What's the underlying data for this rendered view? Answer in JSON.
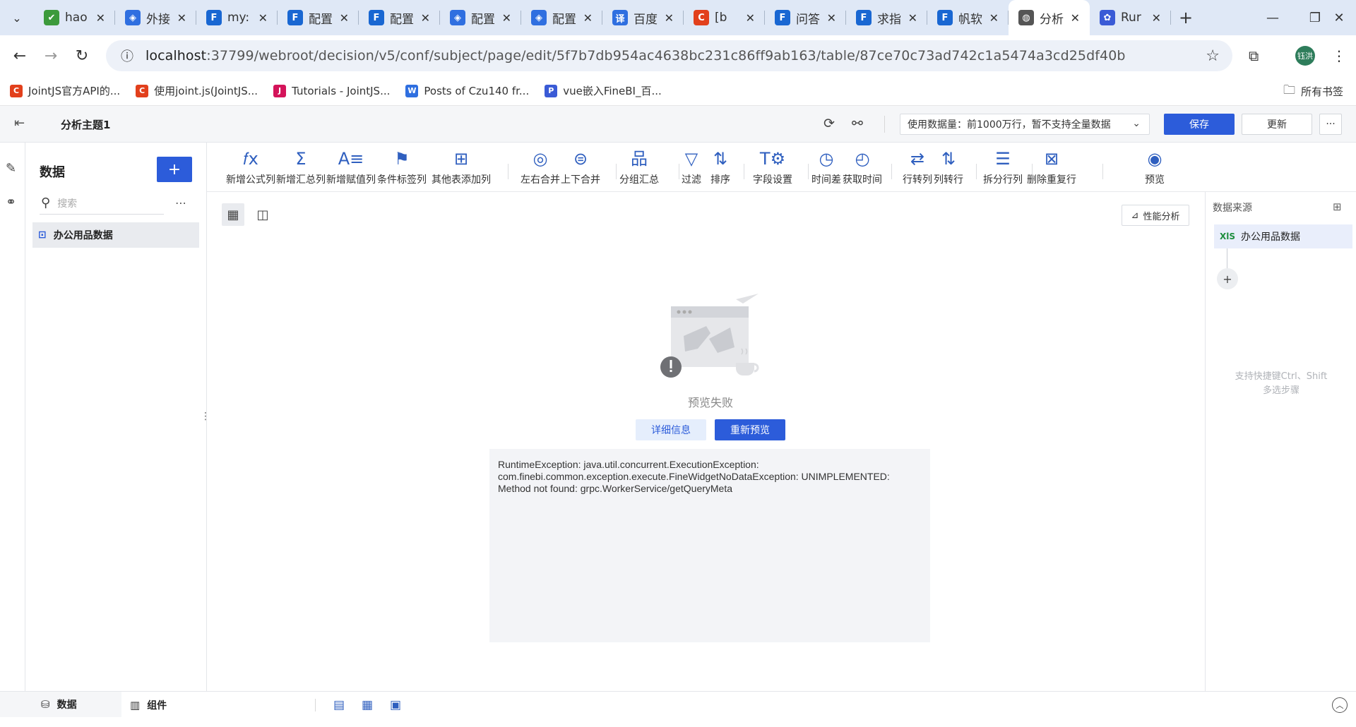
{
  "browser": {
    "tabs": [
      {
        "title": "hao",
        "favicon": "hao",
        "color": "#3c9a3c",
        "active": false
      },
      {
        "title": "外接",
        "favicon": "diamond",
        "color": "#2f6fe0",
        "active": false
      },
      {
        "title": "my:",
        "favicon": "fine",
        "color": "#1967d2",
        "active": false
      },
      {
        "title": "配置",
        "favicon": "fine",
        "color": "#1967d2",
        "active": false
      },
      {
        "title": "配置",
        "favicon": "fine",
        "color": "#1967d2",
        "active": false
      },
      {
        "title": "配置",
        "favicon": "diamond",
        "color": "#2f6fe0",
        "active": false
      },
      {
        "title": "配置",
        "favicon": "diamond",
        "color": "#2f6fe0",
        "active": false
      },
      {
        "title": "百度",
        "favicon": "译",
        "color": "#2f6fe0",
        "active": false
      },
      {
        "title": "[b",
        "favicon": "C",
        "color": "#e2401c",
        "active": false
      },
      {
        "title": "问答",
        "favicon": "fine",
        "color": "#1967d2",
        "active": false
      },
      {
        "title": "求指",
        "favicon": "fine",
        "color": "#1967d2",
        "active": false
      },
      {
        "title": "帆软",
        "favicon": "fine",
        "color": "#1967d2",
        "active": false
      },
      {
        "title": "分析",
        "favicon": "globe",
        "color": "#555555",
        "active": true
      },
      {
        "title": "Rur",
        "favicon": "paw",
        "color": "#3a5bd6",
        "active": false
      }
    ],
    "url_host": "localhost",
    "url_path": ":37799/webroot/decision/v5/conf/subject/page/edit/5f7b7db954ac4638bc231c86ff9ab163/table/87ce70c73ad742c1a5474a3cd25df40b",
    "avatar_text": "钰洪",
    "bookmarks": [
      {
        "label": "JointJS官方API的...",
        "icon": "C",
        "color": "#e2401c"
      },
      {
        "label": "使用joint.js(JointJS...",
        "icon": "C",
        "color": "#e2401c"
      },
      {
        "label": "Tutorials - JointJS...",
        "icon": "J",
        "color": "#d4145a"
      },
      {
        "label": "Posts of Czu140 fr...",
        "icon": "W",
        "color": "#2f6fe0"
      },
      {
        "label": "vue嵌入FineBI_百...",
        "icon": "P",
        "color": "#3a5bd6"
      }
    ],
    "all_bookmarks": "所有书签"
  },
  "app": {
    "title": "分析主题1",
    "data_limit": "使用数据量：前1000万行，暂不支持全量数据",
    "save": "保存",
    "update": "更新",
    "more": "···"
  },
  "data_panel": {
    "heading": "数据",
    "add": "+",
    "search_placeholder": "搜索",
    "item": "办公用品数据"
  },
  "toolbar": [
    {
      "label": "新增公式列",
      "icon": "𝑓x"
    },
    {
      "label": "新增汇总列",
      "icon": "Σ"
    },
    {
      "label": "新增赋值列",
      "icon": "A≡"
    },
    {
      "label": "条件标签列",
      "icon": "⚑"
    },
    {
      "label": "其他表添加列",
      "icon": "⊞"
    },
    {
      "label": "左右合并",
      "icon": "◎"
    },
    {
      "label": "上下合并",
      "icon": "⊜"
    },
    {
      "label": "分组汇总",
      "icon": "品"
    },
    {
      "label": "过滤",
      "icon": "▽"
    },
    {
      "label": "排序",
      "icon": "⇅"
    },
    {
      "label": "字段设置",
      "icon": "T⚙"
    },
    {
      "label": "时间差",
      "icon": "◷"
    },
    {
      "label": "获取时间",
      "icon": "◴"
    },
    {
      "label": "行转列",
      "icon": "⇄"
    },
    {
      "label": "列转行",
      "icon": "⇅"
    },
    {
      "label": "拆分行列",
      "icon": "☰"
    },
    {
      "label": "删除重复行",
      "icon": "⊠"
    },
    {
      "label": "预览",
      "icon": "◉"
    }
  ],
  "main": {
    "perf_label": "性能分析",
    "fail_text": "预览失败",
    "detail_btn": "详细信息",
    "retry_btn": "重新预览",
    "error_line1": "RuntimeException: java.util.concurrent.ExecutionException:",
    "error_line2": "com.finebi.common.exception.execute.FineWidgetNoDataException: UNIMPLEMENTED:",
    "error_line3": "Method not found: grpc.WorkerService/getQueryMeta"
  },
  "right_panel": {
    "heading": "数据来源",
    "source_badge": "XlS",
    "source": "办公用品数据",
    "add": "+",
    "hint_line1": "支持快捷键Ctrl、Shift",
    "hint_line2": "多选步骤"
  },
  "bottom": {
    "tab_data": "数据",
    "tab_component": "组件"
  }
}
